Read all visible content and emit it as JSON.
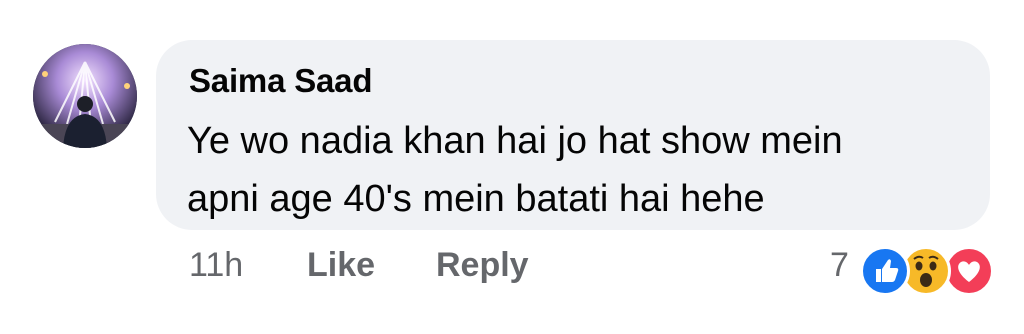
{
  "comment": {
    "author": "Saima Saad",
    "text_lines": [
      "Ye wo nadia khan hai jo hat show mein",
      "apni age 40's mein batati hai hehe"
    ]
  },
  "actions": {
    "timestamp": "11h",
    "like_label": "Like",
    "reply_label": "Reply"
  },
  "reactions": {
    "count": "7",
    "types": [
      "like-icon",
      "wow-icon",
      "love-icon"
    ],
    "colors": {
      "like": "#1877f2",
      "wow": "#f7b928",
      "love": "#f33e58"
    }
  },
  "colors": {
    "bubble": "#f0f2f5",
    "secondary_text": "#65676b",
    "primary_text": "#050505"
  }
}
